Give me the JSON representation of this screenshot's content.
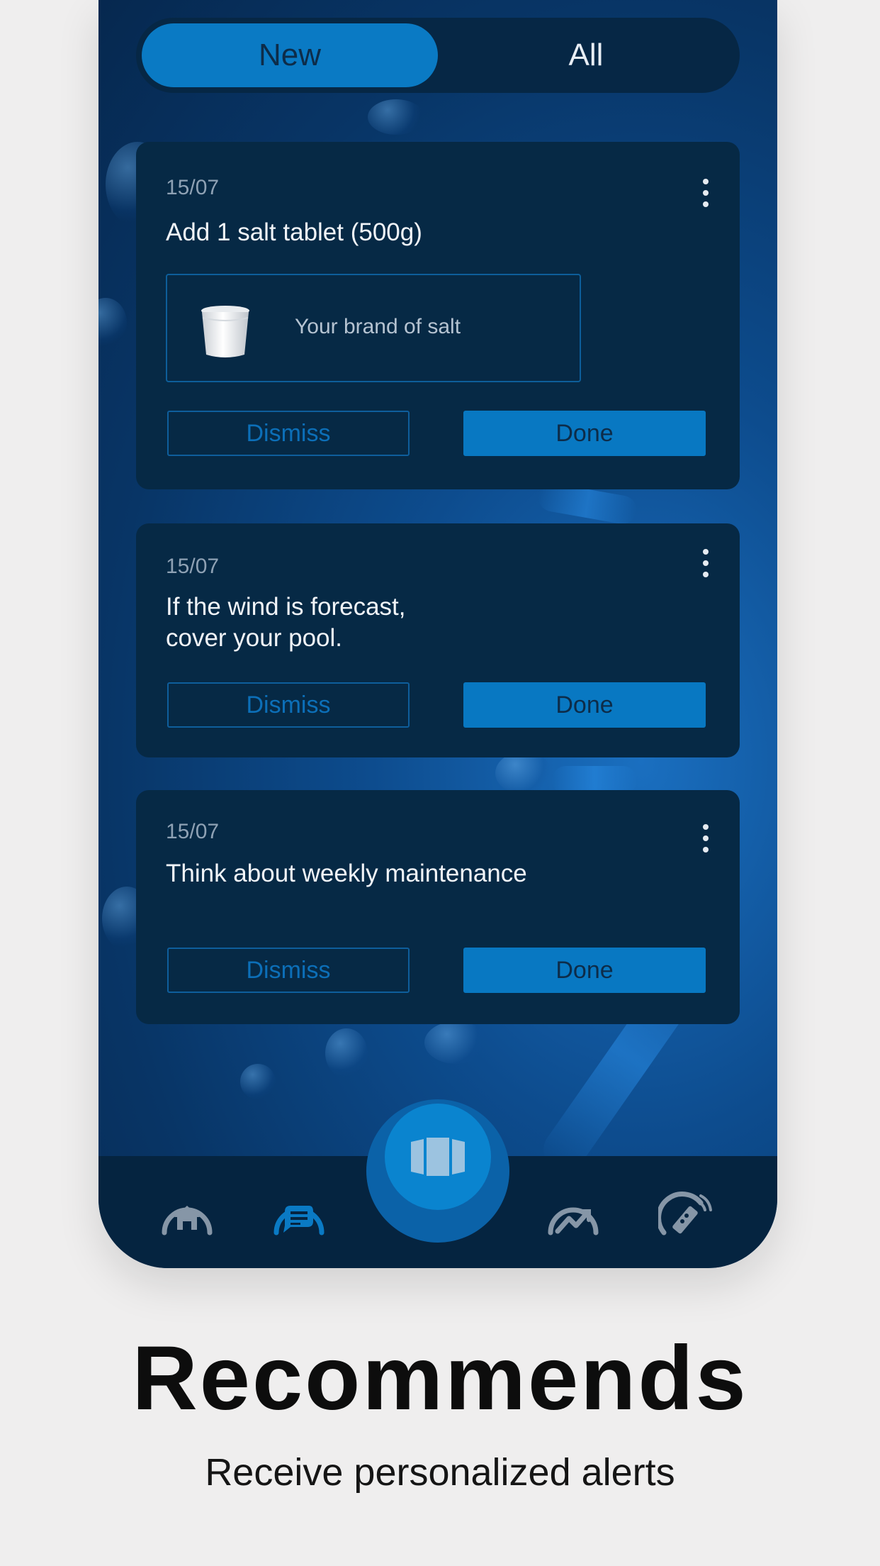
{
  "segmented": {
    "new_label": "New",
    "all_label": "All",
    "selected": "New"
  },
  "cards": [
    {
      "date": "15/07",
      "title": "Add 1 salt tablet (500g)",
      "product": {
        "label": "Your brand of salt",
        "icon": "salt-bucket-icon"
      },
      "dismiss_label": "Dismiss",
      "done_label": "Done"
    },
    {
      "date": "15/07",
      "title_line1": "If the wind is forecast,",
      "title_line2": "cover your pool.",
      "dismiss_label": "Dismiss",
      "done_label": "Done"
    },
    {
      "date": "15/07",
      "title": "Think about weekly maintenance",
      "dismiss_label": "Dismiss",
      "done_label": "Done"
    }
  ],
  "tabbar": {
    "items": [
      "home-icon",
      "recommendations-icon",
      "pool-device-icon",
      "analytics-icon",
      "remote-control-icon"
    ],
    "active": "recommendations-icon"
  },
  "promo": {
    "headline": "Recommends",
    "subline": "Receive personalized alerts"
  },
  "colors": {
    "accent": "#0a7ac4",
    "card": "#062945",
    "background": "#efeeee"
  }
}
